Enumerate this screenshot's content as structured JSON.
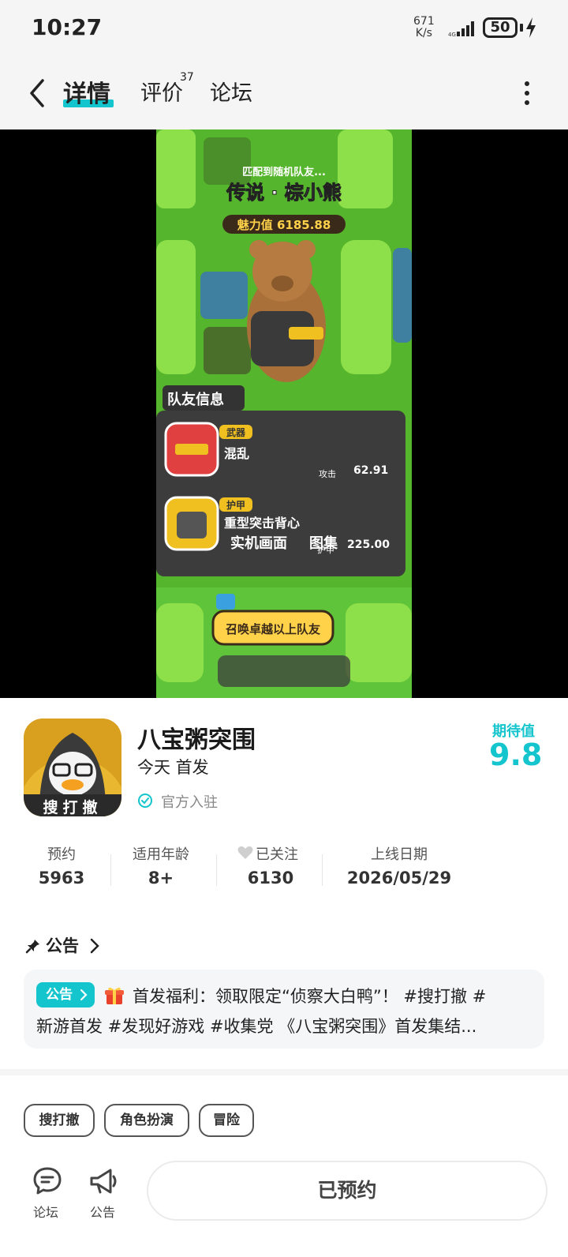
{
  "status_bar": {
    "time": "10:27",
    "net_speed_value": "671",
    "net_speed_unit": "K/s",
    "battery": "50",
    "icons": [
      "signal-icon",
      "battery-icon",
      "charging-icon"
    ]
  },
  "nav": {
    "tabs": [
      {
        "label": "详情",
        "active": true
      },
      {
        "label": "评价",
        "count": "37"
      },
      {
        "label": "论坛"
      }
    ],
    "icons": [
      "back-icon",
      "more-icon"
    ]
  },
  "media": {
    "buttons": [
      "实机画面",
      "图集"
    ]
  },
  "game": {
    "title": "八宝粥突围",
    "icon_text": "搜打撤",
    "release": "今天 首发",
    "official": "官方入驻",
    "expect_label": "期待值",
    "expect_value": "9.8"
  },
  "stats": [
    {
      "label": "预约",
      "value": "5963"
    },
    {
      "label": "适用年龄",
      "value": "8+"
    },
    {
      "label": "已关注",
      "value": "6130"
    },
    {
      "label": "上线日期",
      "value": "2026/05/29"
    }
  ],
  "announcement": {
    "section_title": "公告",
    "badge": "公告",
    "line1": "首发福利：领取限定“侦察大白鸭”！ #搜打撤 #",
    "line2": "新游首发 #发现好游戏 #收集党 《八宝粥突围》首发集结..."
  },
  "tags": [
    "搜打撤",
    "角色扮演",
    "冒险"
  ],
  "bottom_bar": {
    "forum_label": "论坛",
    "notice_label": "公告",
    "reserve_label": "已预约"
  },
  "colors": {
    "accent": "#15c5ce",
    "page_bg": "#f5f5f5"
  }
}
